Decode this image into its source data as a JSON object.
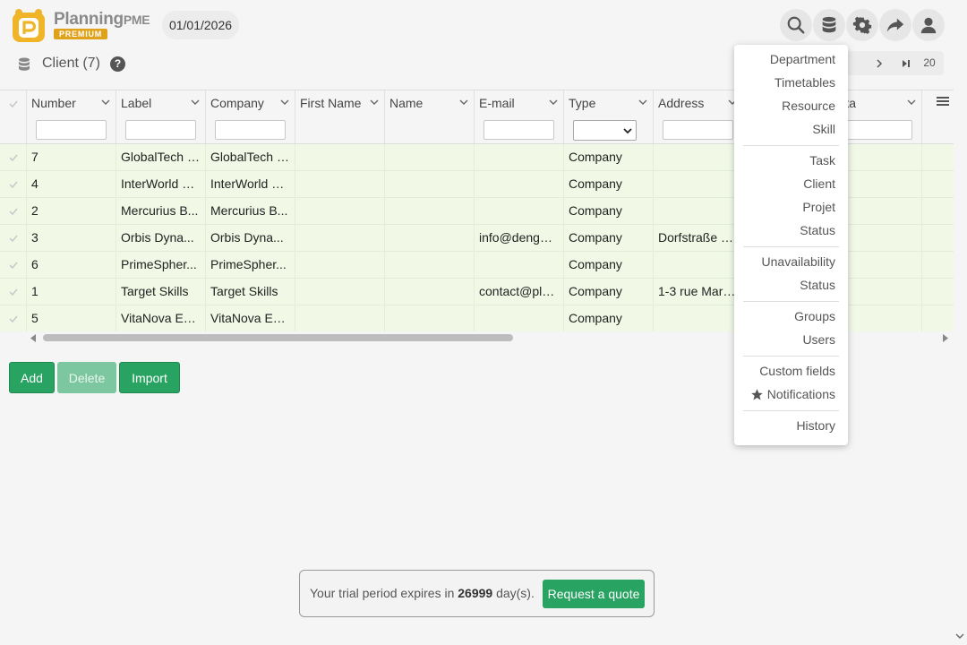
{
  "header": {
    "brand_name": "Planning",
    "brand_suffix": "PME",
    "badge": "PREMIUM",
    "date": "01/01/2026",
    "icons": [
      "search-icon",
      "database-icon",
      "gear-icon",
      "share-icon",
      "user-icon"
    ]
  },
  "subheader": {
    "title": "Client (7)",
    "help": "?",
    "page_size": "20"
  },
  "table": {
    "columns": [
      {
        "label": "Number",
        "filter": "text"
      },
      {
        "label": "Label",
        "filter": "text"
      },
      {
        "label": "Company",
        "filter": "text"
      },
      {
        "label": "First Name",
        "filter": "none"
      },
      {
        "label": "Name",
        "filter": "none"
      },
      {
        "label": "E-mail",
        "filter": "text"
      },
      {
        "label": "Type",
        "filter": "select"
      },
      {
        "label": "Address",
        "filter": "text"
      },
      {
        "label": "ty",
        "filter": "text"
      },
      {
        "label": "Sta",
        "filter": "text"
      }
    ],
    "rows": [
      [
        "7",
        "GlobalTech I...",
        "GlobalTech I...",
        "",
        "",
        "",
        "Company",
        "",
        "",
        ""
      ],
      [
        "4",
        "InterWorld S...",
        "InterWorld S...",
        "",
        "",
        "",
        "Company",
        "",
        "",
        ""
      ],
      [
        "2",
        "Mercurius B...",
        "Mercurius B...",
        "",
        "",
        "",
        "Company",
        "",
        "",
        ""
      ],
      [
        "3",
        "Orbis Dyna...",
        "Orbis Dyna...",
        "",
        "",
        "info@dengel...",
        "Company",
        "Dorfstraße 2...",
        "",
        ""
      ],
      [
        "6",
        "PrimeSpher...",
        "PrimeSpher...",
        "",
        "",
        "",
        "Company",
        "",
        "",
        ""
      ],
      [
        "1",
        "Target Skills",
        "Target Skills",
        "",
        "",
        "contact@pla...",
        "Company",
        "1-3 rue Marc...",
        "",
        ""
      ],
      [
        "5",
        "VitaNova En...",
        "VitaNova En...",
        "",
        "",
        "",
        "Company",
        "",
        "",
        ""
      ]
    ]
  },
  "actions": {
    "add": "Add",
    "delete": "Delete",
    "import": "Import"
  },
  "menu": {
    "group1": [
      "Department",
      "Timetables",
      "Resource",
      "Skill"
    ],
    "group2": [
      "Task",
      "Client",
      "Projet",
      "Status"
    ],
    "group3": [
      "Unavailability",
      "Status"
    ],
    "group4": [
      "Groups",
      "Users"
    ],
    "group5": [
      "Custom fields",
      "Notifications"
    ],
    "group6": [
      "History"
    ]
  },
  "trial": {
    "prefix": "Your trial period expires in ",
    "days": "26999",
    "suffix": " day(s).",
    "button": "Request a quote"
  },
  "colors": {
    "accent": "#28a361",
    "row_bg": "#f1f9e6",
    "premium": "#e0a21a",
    "logo": "#f0b429"
  }
}
